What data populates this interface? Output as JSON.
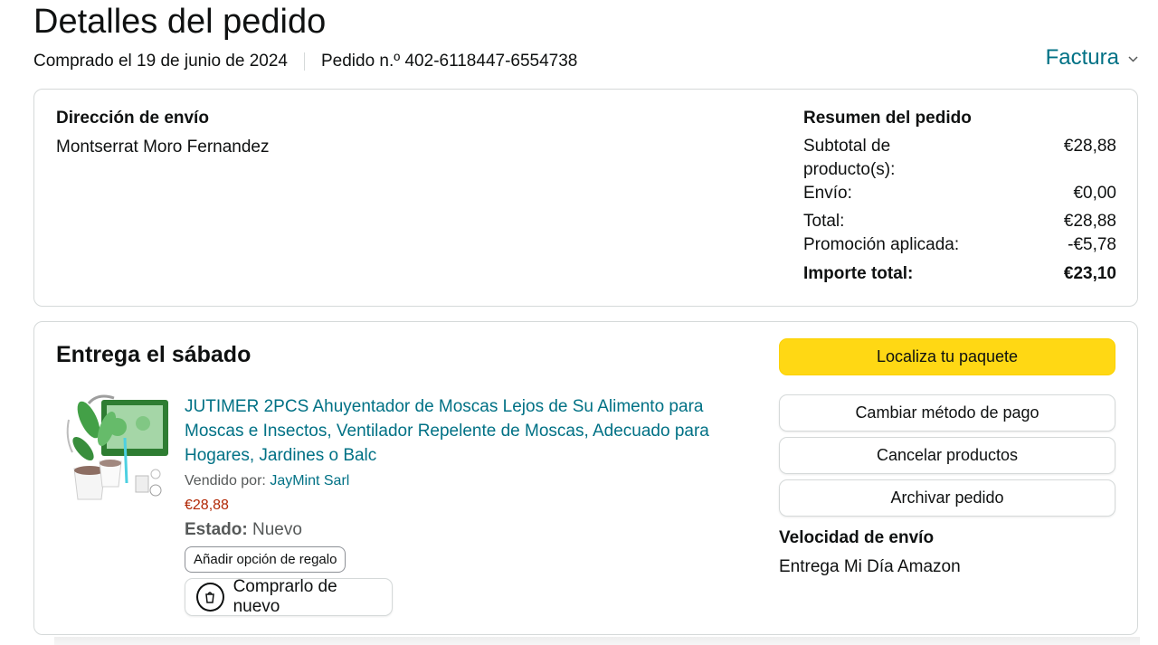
{
  "header": {
    "title": "Detalles del pedido",
    "purchased": "Comprado el 19 de junio de 2024",
    "order_number": "Pedido n.º 402-6118447-6554738",
    "invoice_label": "Factura",
    "invoice_icon": "chevron-down-icon"
  },
  "shipping": {
    "label": "Dirección de envío",
    "name": "Montserrat Moro Fernandez"
  },
  "summary": {
    "label": "Resumen del pedido",
    "rows": [
      {
        "key": "Subtotal de producto(s):",
        "value": "€28,88"
      },
      {
        "key": "Envío:",
        "value": "€0,00"
      },
      {
        "key": "Total:",
        "value": "€28,88"
      },
      {
        "key": "Promoción aplicada:",
        "value": "-€5,78"
      }
    ],
    "grand_total_label": "Importe total:",
    "grand_total_value": "€23,10"
  },
  "delivery": {
    "heading": "Entrega el sábado",
    "product": {
      "title": "JUTIMER 2PCS Ahuyentador de Moscas Lejos de Su Alimento para Moscas e Insectos, Ventilador Repelente de Moscas, Adecuado para Hogares, Jardines o Balc",
      "sold_by_label": "Vendido por:",
      "seller": "JayMint Sarl",
      "price": "€28,88",
      "state_label": "Estado:",
      "state_value": "Nuevo",
      "gift_button": "Añadir opción de regalo",
      "rebuy_button": "Comprarlo de nuevo",
      "rebuy_icon": "rebuy-icon"
    },
    "actions": {
      "track": "Localiza tu paquete",
      "change_payment": "Cambiar método de pago",
      "cancel": "Cancelar productos",
      "archive": "Archivar pedido"
    },
    "speed_label": "Velocidad de envío",
    "speed_value": "Entrega Mi Día Amazon"
  },
  "colors": {
    "link": "#007185",
    "price": "#b12704",
    "primary_button": "#ffd814",
    "border": "#d5d9d9"
  }
}
